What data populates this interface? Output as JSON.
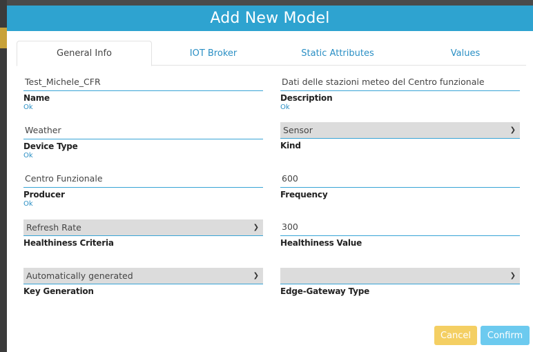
{
  "modal": {
    "title": "Add New Model"
  },
  "tabs": [
    {
      "label": "General Info",
      "active": true
    },
    {
      "label": "IOT Broker",
      "active": false
    },
    {
      "label": "Static Attributes",
      "active": false
    },
    {
      "label": "Values",
      "active": false
    }
  ],
  "fields": {
    "name": {
      "value": "Test_Michele_CFR",
      "label": "Name",
      "status": "Ok"
    },
    "description": {
      "value": "Dati delle stazioni meteo del Centro funzionale",
      "label": "Description",
      "status": "Ok"
    },
    "device_type": {
      "value": "Weather",
      "label": "Device Type",
      "status": "Ok"
    },
    "kind": {
      "value": "Sensor",
      "label": "Kind"
    },
    "producer": {
      "value": "Centro Funzionale",
      "label": "Producer",
      "status": "Ok"
    },
    "frequency": {
      "value": "600",
      "label": "Frequency"
    },
    "healthiness_criteria": {
      "value": "Refresh Rate",
      "label": "Healthiness Criteria"
    },
    "healthiness_value": {
      "value": "300",
      "label": "Healthiness Value"
    },
    "key_generation": {
      "value": "Automatically generated",
      "label": "Key Generation"
    },
    "edge_gateway_type": {
      "value": "",
      "label": "Edge-Gateway Type"
    }
  },
  "buttons": {
    "cancel": "Cancel",
    "confirm": "Confirm"
  },
  "colors": {
    "header": "#2ea3d0",
    "tab_link": "#2a8fc4",
    "underline": "#36a3d5",
    "cancel": "#f4cf63",
    "confirm": "#6ccaef",
    "select_bg": "#dcdcdc"
  },
  "icons": {
    "dropdown": "chevron-down-icon"
  }
}
